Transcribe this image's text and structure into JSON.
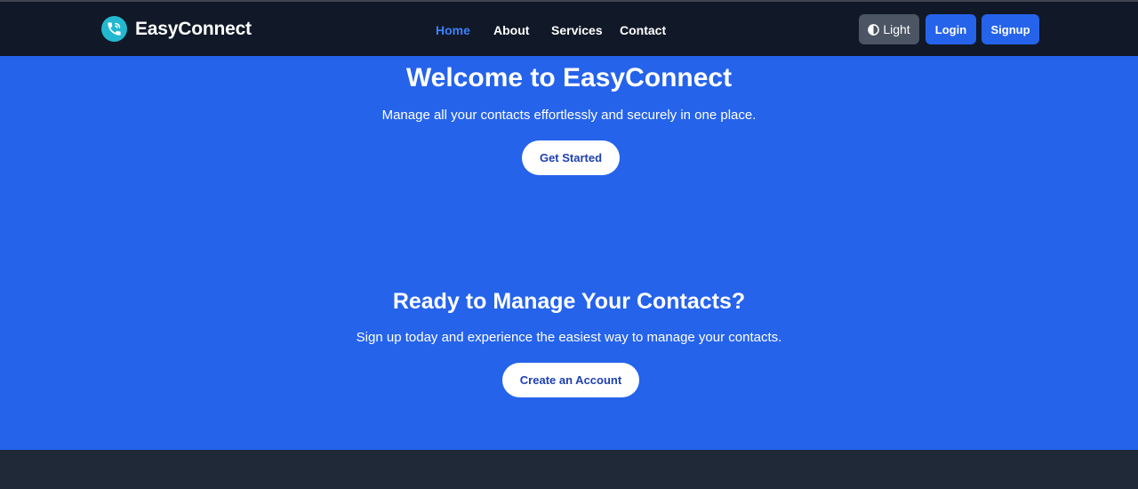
{
  "brand": {
    "name": "EasyConnect",
    "logo_icon": "phone-icon"
  },
  "nav": {
    "links": [
      {
        "label": "Home",
        "active": true
      },
      {
        "label": "About",
        "active": false
      },
      {
        "label": "Services",
        "active": false
      },
      {
        "label": "Contact",
        "active": false
      }
    ],
    "theme_toggle_label": "Light",
    "login_label": "Login",
    "signup_label": "Signup"
  },
  "hero": {
    "title": "Welcome to EasyConnect",
    "subtitle": "Manage all your contacts effortlessly and securely in one place.",
    "cta_label": "Get Started"
  },
  "cta_section": {
    "title": "Ready to Manage Your Contacts?",
    "subtitle": "Sign up today and experience the easiest way to manage your contacts.",
    "cta_label": "Create an Account"
  },
  "colors": {
    "navbar_bg": "#111827",
    "accent": "#2563eb",
    "active_link": "#3b82f6",
    "logo": "#22b8cf",
    "footer_bg": "#1f2937"
  }
}
